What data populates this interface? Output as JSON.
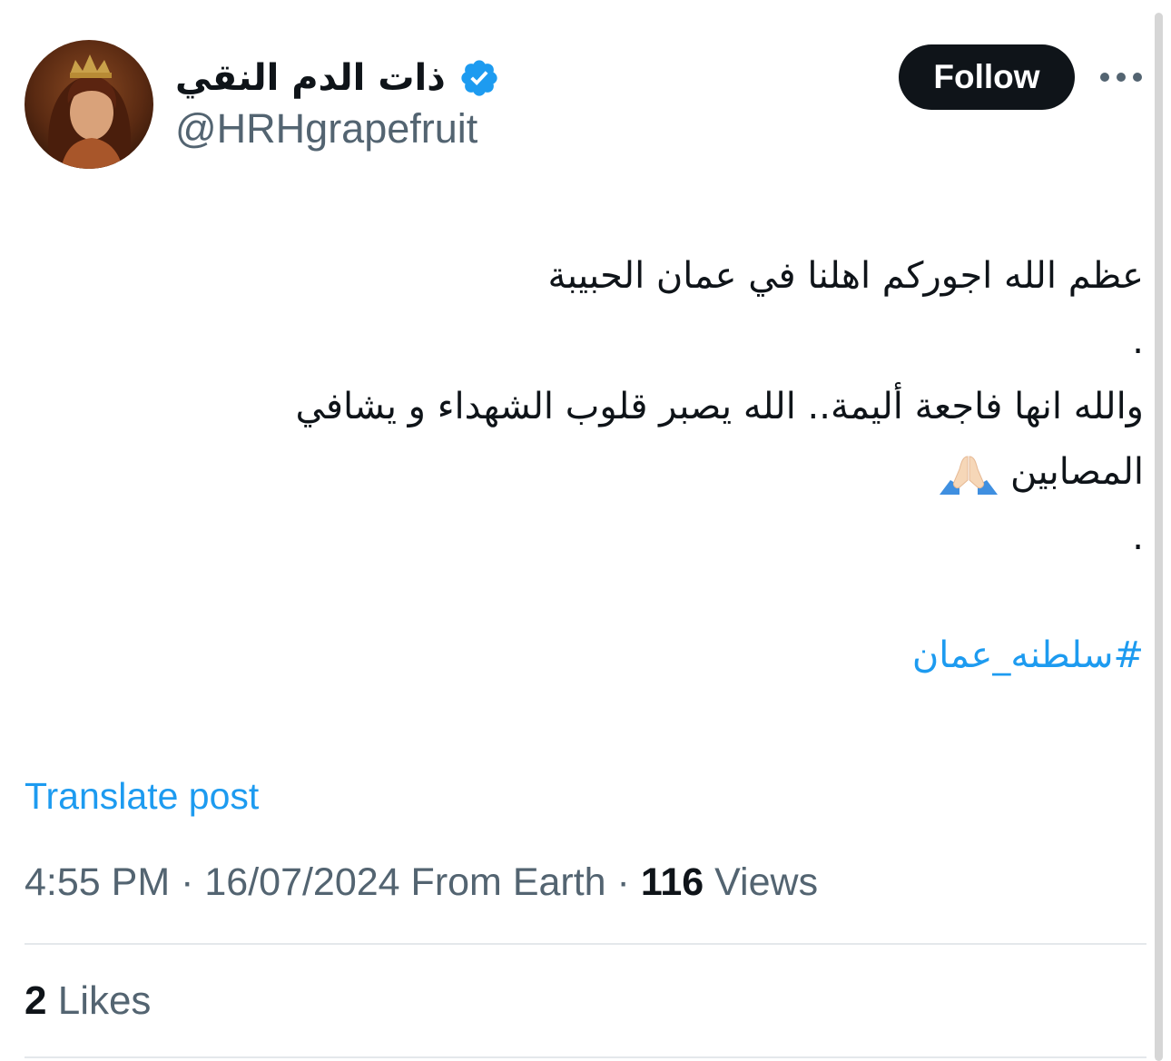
{
  "author": {
    "display_name": "ذات الدم النقي",
    "handle": "@HRHgrapefruit",
    "verified": true,
    "verified_color": "#1d9bf0"
  },
  "actions": {
    "follow_label": "Follow"
  },
  "tweet": {
    "lines": [
      "عظم الله اجوركم اهلنا في عمان الحبيبة",
      ".",
      "والله انها فاجعة أليمة.. الله يصبر قلوب الشهداء و يشافي",
      "المصابين"
    ],
    "emoji": "folded-hands",
    "closing_dot": ".",
    "hashtag": "#سلطنه_عمان"
  },
  "translate_label": "Translate post",
  "meta": {
    "time": "4:55 PM",
    "separator": "·",
    "date": "16/07/2024",
    "source": "From Earth",
    "views_count": "116",
    "views_label": "Views"
  },
  "engagement": {
    "likes_count": "2",
    "likes_label": "Likes"
  },
  "colors": {
    "text": "#0f1419",
    "secondary": "#536471",
    "accent": "#1d9bf0",
    "divider": "#e4e8eb"
  }
}
